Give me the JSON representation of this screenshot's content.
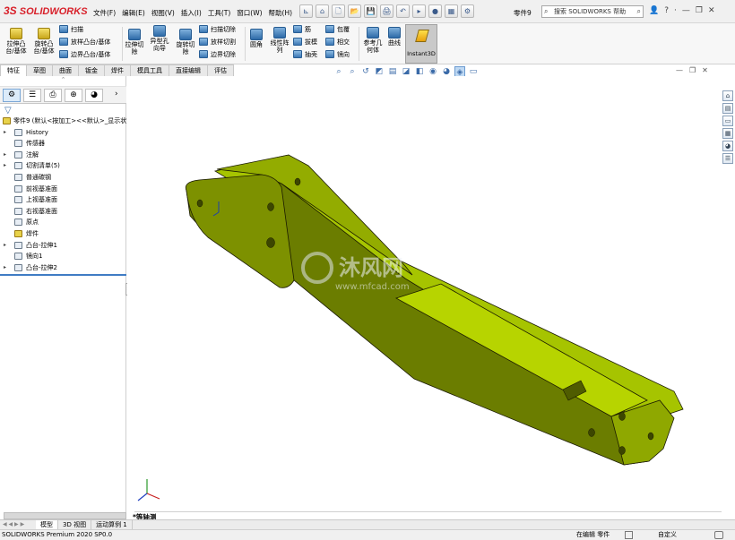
{
  "app": {
    "brand": "SOLIDWORKS",
    "brand_mark": "3S",
    "window_controls": [
      "—",
      "❐",
      "✕"
    ]
  },
  "menu": [
    "文件(F)",
    "编辑(E)",
    "视图(V)",
    "插入(I)",
    "工具(T)",
    "窗口(W)",
    "帮助(H)"
  ],
  "quick_access": [
    "⌂",
    "🗋",
    "📂",
    "💾",
    "🖨",
    "↶",
    "▸",
    "●",
    "▦",
    "⚙"
  ],
  "document": {
    "name": "零件9"
  },
  "search": {
    "placeholder": "搜索 SOLIDWORKS 帮助"
  },
  "title_right": [
    "👤",
    "?",
    "·",
    "—",
    "❐",
    "✕"
  ],
  "ribbon": {
    "big": [
      {
        "label": "拉伸凸\n台/基体"
      },
      {
        "label": "旋转凸\n台/基体"
      }
    ],
    "stack1": [
      "扫描",
      "放样凸台/基体",
      "边界凸台/基体"
    ],
    "mid": [
      {
        "label": "拉伸切\n除"
      },
      {
        "label": "异型孔\n向导"
      },
      {
        "label": "旋转切\n除"
      }
    ],
    "stack2": [
      "扫描切除",
      "放样切割",
      "边界切除"
    ],
    "mid2": [
      {
        "label": "圆角"
      },
      {
        "label": "线性阵\n列"
      }
    ],
    "stack3": [
      "筋",
      "拔模",
      "抽壳"
    ],
    "stack4": [
      "包覆",
      "相交",
      "镜向"
    ],
    "mid3": [
      {
        "label": "参考几\n何体"
      },
      {
        "label": "曲线"
      }
    ],
    "instant3d": "Instant3D"
  },
  "tabs": [
    "特征",
    "草图",
    "曲面",
    "钣金",
    "焊件",
    "模具工具",
    "直接编辑",
    "评估"
  ],
  "panel_tabs": [
    "⚙",
    "☰",
    "⎙",
    "⊕",
    "◕"
  ],
  "tree": {
    "root": "零件9 (默认<按加工><<默认>_显示状",
    "items": [
      {
        "label": "History",
        "expand": "▸"
      },
      {
        "label": "传感器",
        "expand": ""
      },
      {
        "label": "注解",
        "expand": "▸"
      },
      {
        "label": "切割清单(5)",
        "expand": "▸"
      },
      {
        "label": "普通碳钢",
        "expand": ""
      },
      {
        "label": "前视基准面",
        "expand": ""
      },
      {
        "label": "上视基准面",
        "expand": ""
      },
      {
        "label": "右视基准面",
        "expand": ""
      },
      {
        "label": "原点",
        "expand": ""
      },
      {
        "label": "焊件",
        "expand": ""
      },
      {
        "label": "凸台-拉伸1",
        "expand": "▸"
      },
      {
        "label": "镜向1",
        "expand": ""
      },
      {
        "label": "凸台-拉伸2",
        "expand": "▸"
      }
    ]
  },
  "bottom_tabs": [
    "模型",
    "3D 视图",
    "运动算例 1"
  ],
  "bottom_nav": "◀ ◀ ▶ ▶",
  "view_label": "*等轴测",
  "watermark": {
    "text": "沐风网",
    "url": "www.mfcad.com"
  },
  "status": {
    "product": "SOLIDWORKS Premium 2020 SP0.0",
    "editing": "在编辑 零件",
    "units": "自定义"
  },
  "colors": {
    "part_top": "#a8c800",
    "part_side": "#6d7f00",
    "part_face": "#8ea400",
    "edge": "#1a1a00"
  }
}
